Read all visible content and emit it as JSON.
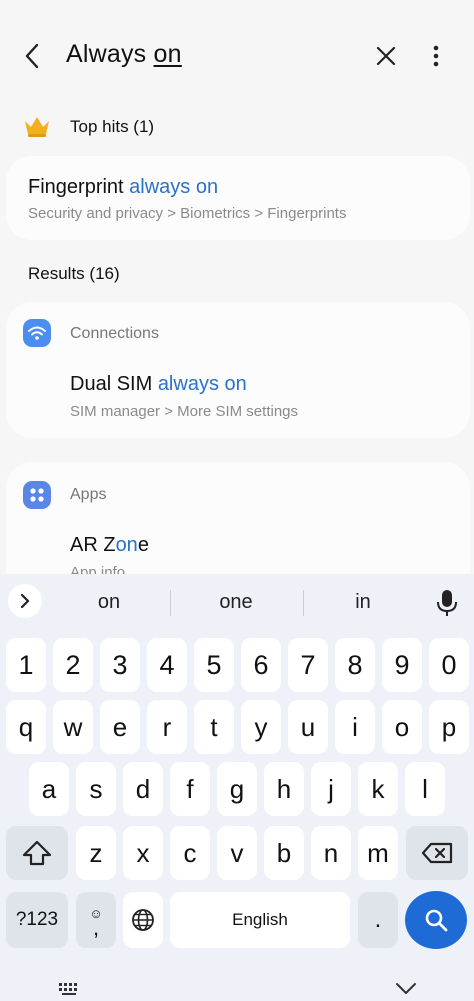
{
  "header": {
    "query_prefix": "Always ",
    "query_underlined": "on"
  },
  "top_hits": {
    "title": "Top hits (1)",
    "items": [
      {
        "title_prefix": "Fingerprint ",
        "title_highlight": "always on",
        "path": "Security and privacy > Biometrics > Fingerprints"
      }
    ]
  },
  "results": {
    "title": "Results (16)",
    "groups": [
      {
        "category": "Connections",
        "icon": "wifi-icon",
        "color": "#4c8ef0",
        "title_prefix": "Dual SIM ",
        "title_highlight": "always on",
        "title_suffix": "",
        "path": "SIM manager > More SIM settings"
      },
      {
        "category": "Apps",
        "icon": "apps-icon",
        "color": "#5a86e6",
        "title_prefix": "AR Z",
        "title_highlight": "on",
        "title_suffix": "e",
        "path": "App info"
      }
    ]
  },
  "keyboard": {
    "suggestions": [
      "on",
      "one",
      "in"
    ],
    "row_numbers": [
      "1",
      "2",
      "3",
      "4",
      "5",
      "6",
      "7",
      "8",
      "9",
      "0"
    ],
    "row_q": [
      "q",
      "w",
      "e",
      "r",
      "t",
      "y",
      "u",
      "i",
      "o",
      "p"
    ],
    "row_a": [
      "a",
      "s",
      "d",
      "f",
      "g",
      "h",
      "j",
      "k",
      "l"
    ],
    "row_z": [
      "z",
      "x",
      "c",
      "v",
      "b",
      "n",
      "m"
    ],
    "symbols_label": "?123",
    "comma_label": ",",
    "space_label": "English",
    "period_label": ".",
    "accent_color": "#1f6bd6"
  }
}
